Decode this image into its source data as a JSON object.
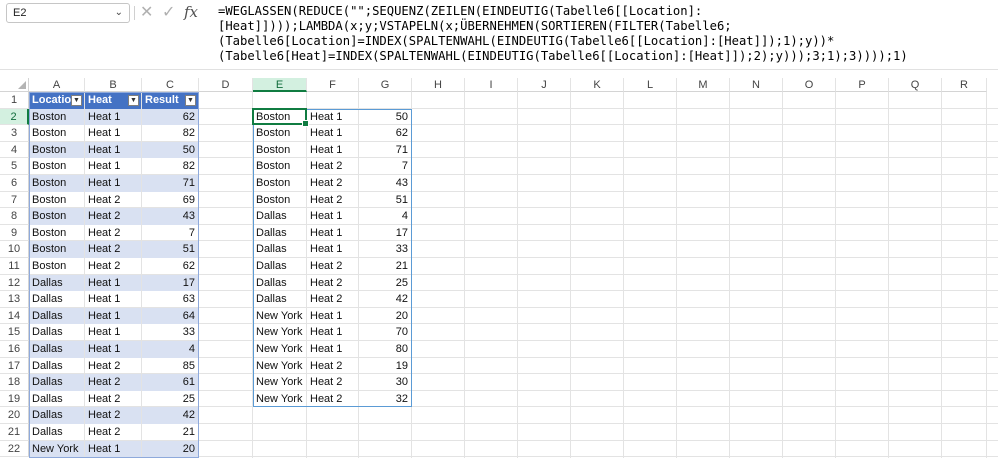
{
  "name_box": {
    "value": "E2"
  },
  "formula_bar": {
    "fx_label": "fx",
    "lines": [
      "=WEGLASSEN(REDUCE(\"\";SEQUENZ(ZEILEN(EINDEUTIG(Tabelle6[[Location]:",
      "[Heat]])));LAMBDA(x;y;VSTAPELN(x;ÜBERNEHMEN(SORTIEREN(FILTER(Tabelle6;",
      "(Tabelle6[Location]=INDEX(SPALTENWAHL(EINDEUTIG(Tabelle6[[Location]:[Heat]]);1);y))*",
      "(Tabelle6[Heat]=INDEX(SPALTENWAHL(EINDEUTIG(Tabelle6[[Location]:[Heat]]);2);y)));3;1);3))));1)"
    ]
  },
  "grid": {
    "columns": [
      "A",
      "B",
      "C",
      "D",
      "E",
      "F",
      "G",
      "H",
      "I",
      "J",
      "K",
      "L",
      "M",
      "N",
      "O",
      "P",
      "Q",
      "R"
    ],
    "selected_column": "E",
    "rows": [
      "1",
      "2",
      "3",
      "4",
      "5",
      "6",
      "7",
      "8",
      "9",
      "10",
      "11",
      "12",
      "13",
      "14",
      "15",
      "16",
      "17",
      "18",
      "19",
      "20",
      "21",
      "22"
    ],
    "selected_row": "2"
  },
  "table": {
    "headers": [
      "Location",
      "Heat",
      "Result"
    ],
    "rows": [
      [
        "Boston",
        "Heat 1",
        "62"
      ],
      [
        "Boston",
        "Heat 1",
        "82"
      ],
      [
        "Boston",
        "Heat 1",
        "50"
      ],
      [
        "Boston",
        "Heat 1",
        "82"
      ],
      [
        "Boston",
        "Heat 1",
        "71"
      ],
      [
        "Boston",
        "Heat 2",
        "69"
      ],
      [
        "Boston",
        "Heat 2",
        "43"
      ],
      [
        "Boston",
        "Heat 2",
        "7"
      ],
      [
        "Boston",
        "Heat 2",
        "51"
      ],
      [
        "Boston",
        "Heat 2",
        "62"
      ],
      [
        "Dallas",
        "Heat 1",
        "17"
      ],
      [
        "Dallas",
        "Heat 1",
        "63"
      ],
      [
        "Dallas",
        "Heat 1",
        "64"
      ],
      [
        "Dallas",
        "Heat 1",
        "33"
      ],
      [
        "Dallas",
        "Heat 1",
        "4"
      ],
      [
        "Dallas",
        "Heat 2",
        "85"
      ],
      [
        "Dallas",
        "Heat 2",
        "61"
      ],
      [
        "Dallas",
        "Heat 2",
        "25"
      ],
      [
        "Dallas",
        "Heat 2",
        "42"
      ],
      [
        "Dallas",
        "Heat 2",
        "21"
      ],
      [
        "New York",
        "Heat 1",
        "20"
      ]
    ]
  },
  "result": {
    "rows": [
      [
        "Boston",
        "Heat 1",
        "50"
      ],
      [
        "Boston",
        "Heat 1",
        "62"
      ],
      [
        "Boston",
        "Heat 1",
        "71"
      ],
      [
        "Boston",
        "Heat 2",
        "7"
      ],
      [
        "Boston",
        "Heat 2",
        "43"
      ],
      [
        "Boston",
        "Heat 2",
        "51"
      ],
      [
        "Dallas",
        "Heat 1",
        "4"
      ],
      [
        "Dallas",
        "Heat 1",
        "17"
      ],
      [
        "Dallas",
        "Heat 1",
        "33"
      ],
      [
        "Dallas",
        "Heat 2",
        "21"
      ],
      [
        "Dallas",
        "Heat 2",
        "25"
      ],
      [
        "Dallas",
        "Heat 2",
        "42"
      ],
      [
        "New York",
        "Heat 1",
        "20"
      ],
      [
        "New York",
        "Heat 1",
        "70"
      ],
      [
        "New York",
        "Heat 1",
        "80"
      ],
      [
        "New York",
        "Heat 2",
        "19"
      ],
      [
        "New York",
        "Heat 2",
        "30"
      ],
      [
        "New York",
        "Heat 2",
        "32"
      ]
    ]
  },
  "colors": {
    "table_header": "#4472c4",
    "table_band": "#d9e1f2",
    "selection": "#107c41"
  },
  "icons": {
    "name_box_dropdown": "chevron-down-icon",
    "cancel": "close-icon",
    "enter": "check-icon",
    "insert_function": "fx-icon"
  }
}
